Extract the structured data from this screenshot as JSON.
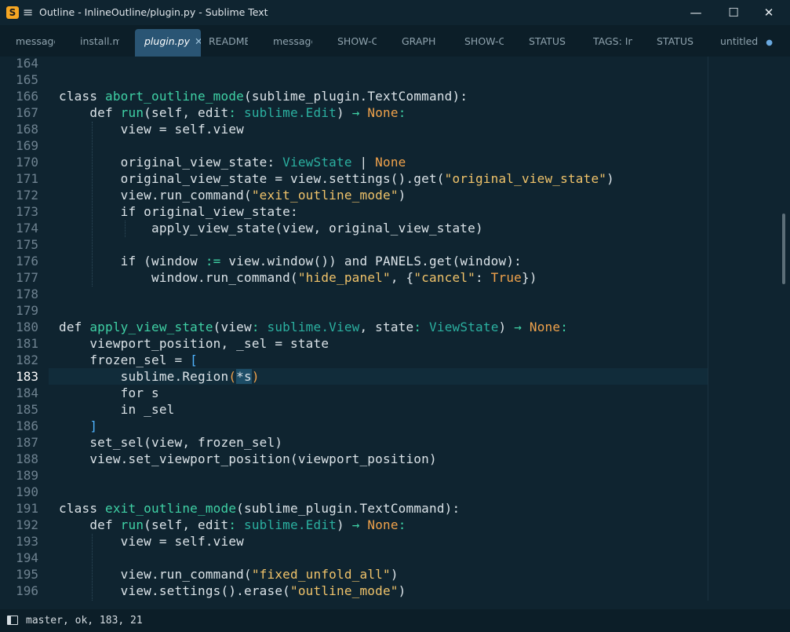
{
  "window": {
    "title": "Outline - InlineOutline/plugin.py - Sublime Text",
    "minimize": "—",
    "maximize": "☐",
    "close": "✕"
  },
  "tabs": [
    {
      "label": "message",
      "active": false
    },
    {
      "label": "install.m",
      "active": false
    },
    {
      "label": "plugin.py",
      "active": true
    },
    {
      "label": "README",
      "active": false
    },
    {
      "label": "message",
      "active": false
    },
    {
      "label": "SHOW-C",
      "active": false
    },
    {
      "label": "GRAPH",
      "active": false
    },
    {
      "label": "SHOW-C",
      "active": false
    },
    {
      "label": "STATUS",
      "active": false
    },
    {
      "label": "TAGS: In",
      "active": false
    },
    {
      "label": "STATUS",
      "active": false
    },
    {
      "label": "untitled",
      "active": false,
      "dirty": true
    }
  ],
  "editor": {
    "current_line": 183,
    "line_numbers": [
      "164",
      "165",
      "166",
      "167",
      "168",
      "169",
      "170",
      "171",
      "172",
      "173",
      "174",
      "175",
      "176",
      "177",
      "178",
      "179",
      "180",
      "181",
      "182",
      "183",
      "184",
      "185",
      "186",
      "187",
      "188",
      "189",
      "190",
      "191",
      "192",
      "193",
      "194",
      "195",
      "196"
    ]
  },
  "status": {
    "text": "master, ok, 183, 21"
  },
  "colors": {
    "background": "#0f2430",
    "function": "#3fd1a5",
    "type": "#2bb0a0",
    "string": "#f0c36a",
    "constant": "#f0a24b",
    "bracket": "#4fb3ff"
  }
}
